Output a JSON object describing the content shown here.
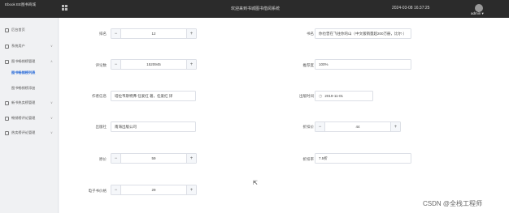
{
  "header": {
    "logo": "Ebook EE图书商城",
    "welcome": "欢迎来到书城图书借阅系统",
    "datetime": "2024-03-08 16:37:25",
    "user": "admin ▾"
  },
  "sidebar": {
    "items": [
      {
        "label": "后台首页"
      },
      {
        "label": "系统用户",
        "chevron": "∨"
      },
      {
        "label": "图书畅销榜管理",
        "chevron": "∧"
      },
      {
        "label": "图书畅销榜列表"
      },
      {
        "label": "图书畅销榜添加"
      },
      {
        "label": "新书热卖榜管理",
        "chevron": "∨"
      },
      {
        "label": "畅销榜评论管理",
        "chevron": "∨"
      },
      {
        "label": "热卖榜评论管理",
        "chevron": "∨"
      }
    ]
  },
  "form": {
    "rank": {
      "label": "排名",
      "value": "12",
      "minus": "−",
      "plus": "+"
    },
    "recommendation": {
      "label": "书名",
      "value": "你也曾在飞往你的山（中文版销量超200万册，比尔·）"
    },
    "rating_count": {
      "label": "评论数",
      "value": "1520945",
      "minus": "−",
      "plus": "+"
    },
    "positive_rate": {
      "label": "推荐度",
      "value": "100%"
    },
    "author": {
      "label": "作者信息",
      "value": "塔拉韦斯特弗 任爱红 著，任爱红 译"
    },
    "publish_date": {
      "label": "出版时间",
      "value": "2019-11-01",
      "icon": "◷"
    },
    "publisher": {
      "label": "出版社",
      "value": "南海出版公司"
    },
    "discount": {
      "label": "折扣价",
      "value": "44",
      "minus": "−",
      "plus": "+"
    },
    "original_price": {
      "label": "原价",
      "value": "59",
      "minus": "−",
      "plus": "+"
    },
    "discount_rate": {
      "label": "折扣率",
      "value": "7.5折"
    },
    "ebook_price": {
      "label": "电子书价格",
      "value": "29",
      "minus": "−",
      "plus": "+"
    }
  },
  "overlay": {
    "cursor": "⇱",
    "watermark": "CSDN @全栈工程师"
  }
}
